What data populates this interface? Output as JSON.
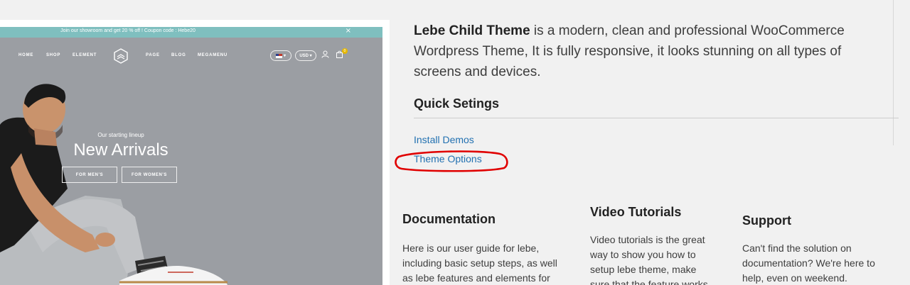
{
  "preview": {
    "promo_text": "Join our showroom and get 20 % off ! Coupon code : Hebe20",
    "promo_close": "×",
    "nav_left": [
      "HOME",
      "SHOP",
      "ELEMENT"
    ],
    "nav_right": [
      "PAGE",
      "BLOG",
      "MEGAMENU"
    ],
    "language_arrow": "▾",
    "currency": "USD ▾",
    "cart_count": "0",
    "hero_subtitle": "Our starting lineup",
    "hero_title": "New Arrivals",
    "btn_men": "FOR MEN'S",
    "btn_women": "FOR WOMEN'S"
  },
  "intro": {
    "theme_name": "Lebe Child Theme",
    "description": " is a modern, clean and professional WooCommerce Wordpress Theme, It is fully responsive, it looks stunning on all types of screens and devices."
  },
  "quick": {
    "title": "Quick Setings",
    "install_demos": "Install Demos",
    "theme_options": "Theme Options"
  },
  "columns": [
    {
      "title": "Documentation",
      "text": "Here is our user guide for lebe, including basic setup steps, as well as lebe features and elements for"
    },
    {
      "title": "Video Tutorials",
      "text": "Video tutorials is the great way to show you how to setup lebe theme, make sure that the feature works"
    },
    {
      "title": "Support",
      "text": "Can't find the solution on documentation? We're here to help, even on weekend."
    }
  ],
  "colors": {
    "accent_link": "#2271b1",
    "promo_bar": "#7fbfbf",
    "annotation": "#e00000"
  }
}
